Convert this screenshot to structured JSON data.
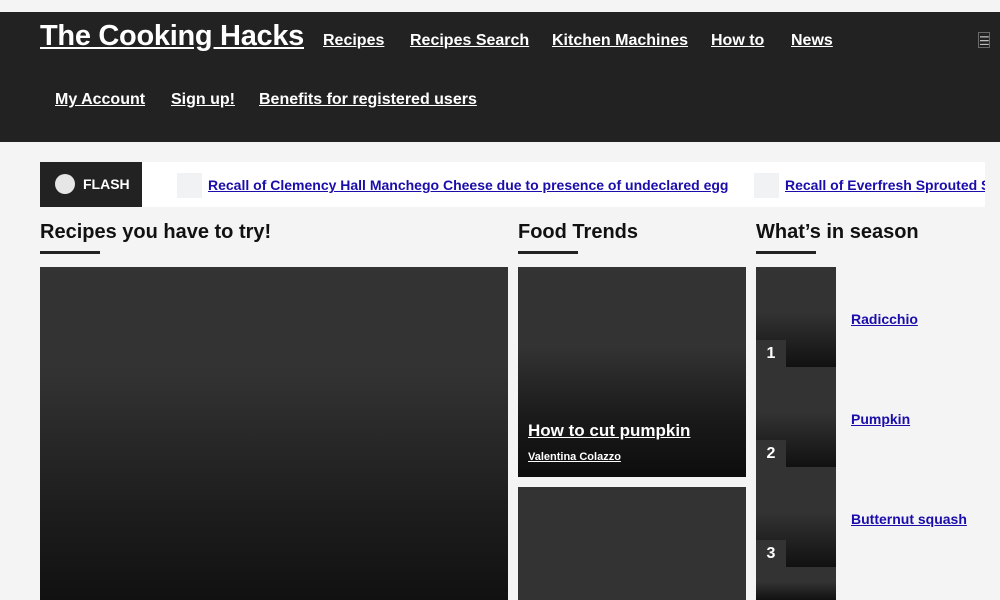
{
  "site": {
    "title": "The Cooking Hacks"
  },
  "nav": {
    "primary": [
      {
        "label": "Recipes"
      },
      {
        "label": "Recipes Search"
      },
      {
        "label": "Kitchen Machines"
      },
      {
        "label": "How to"
      },
      {
        "label": "News"
      }
    ],
    "account": [
      {
        "label": "My Account"
      },
      {
        "label": "Sign up!"
      },
      {
        "label": "Benefits for registered users"
      }
    ],
    "menu_icon": "menu-icon"
  },
  "ticker": {
    "label": "FLASH",
    "items": [
      {
        "text": "Recall of Clemency Hall Manchego Cheese due to presence of undeclared egg"
      },
      {
        "text": "Recall of Everfresh Sprouted Stone Ground Wheat Bread"
      }
    ]
  },
  "sections": {
    "recipes": {
      "title": "Recipes you have to try!"
    },
    "trends": {
      "title": "Food Trends",
      "cards": [
        {
          "title": "How to cut pumpkin",
          "author": "Valentina Colazzo"
        }
      ]
    },
    "season": {
      "title": "What’s in season",
      "items": [
        {
          "rank": "1",
          "name": "Radicchio"
        },
        {
          "rank": "2",
          "name": "Pumpkin"
        },
        {
          "rank": "3",
          "name": "Butternut squash"
        }
      ]
    }
  },
  "colors": {
    "header_bg": "#222222",
    "page_bg": "#f4f4f4",
    "link": "#1a0dab",
    "card_bg": "#333333"
  }
}
